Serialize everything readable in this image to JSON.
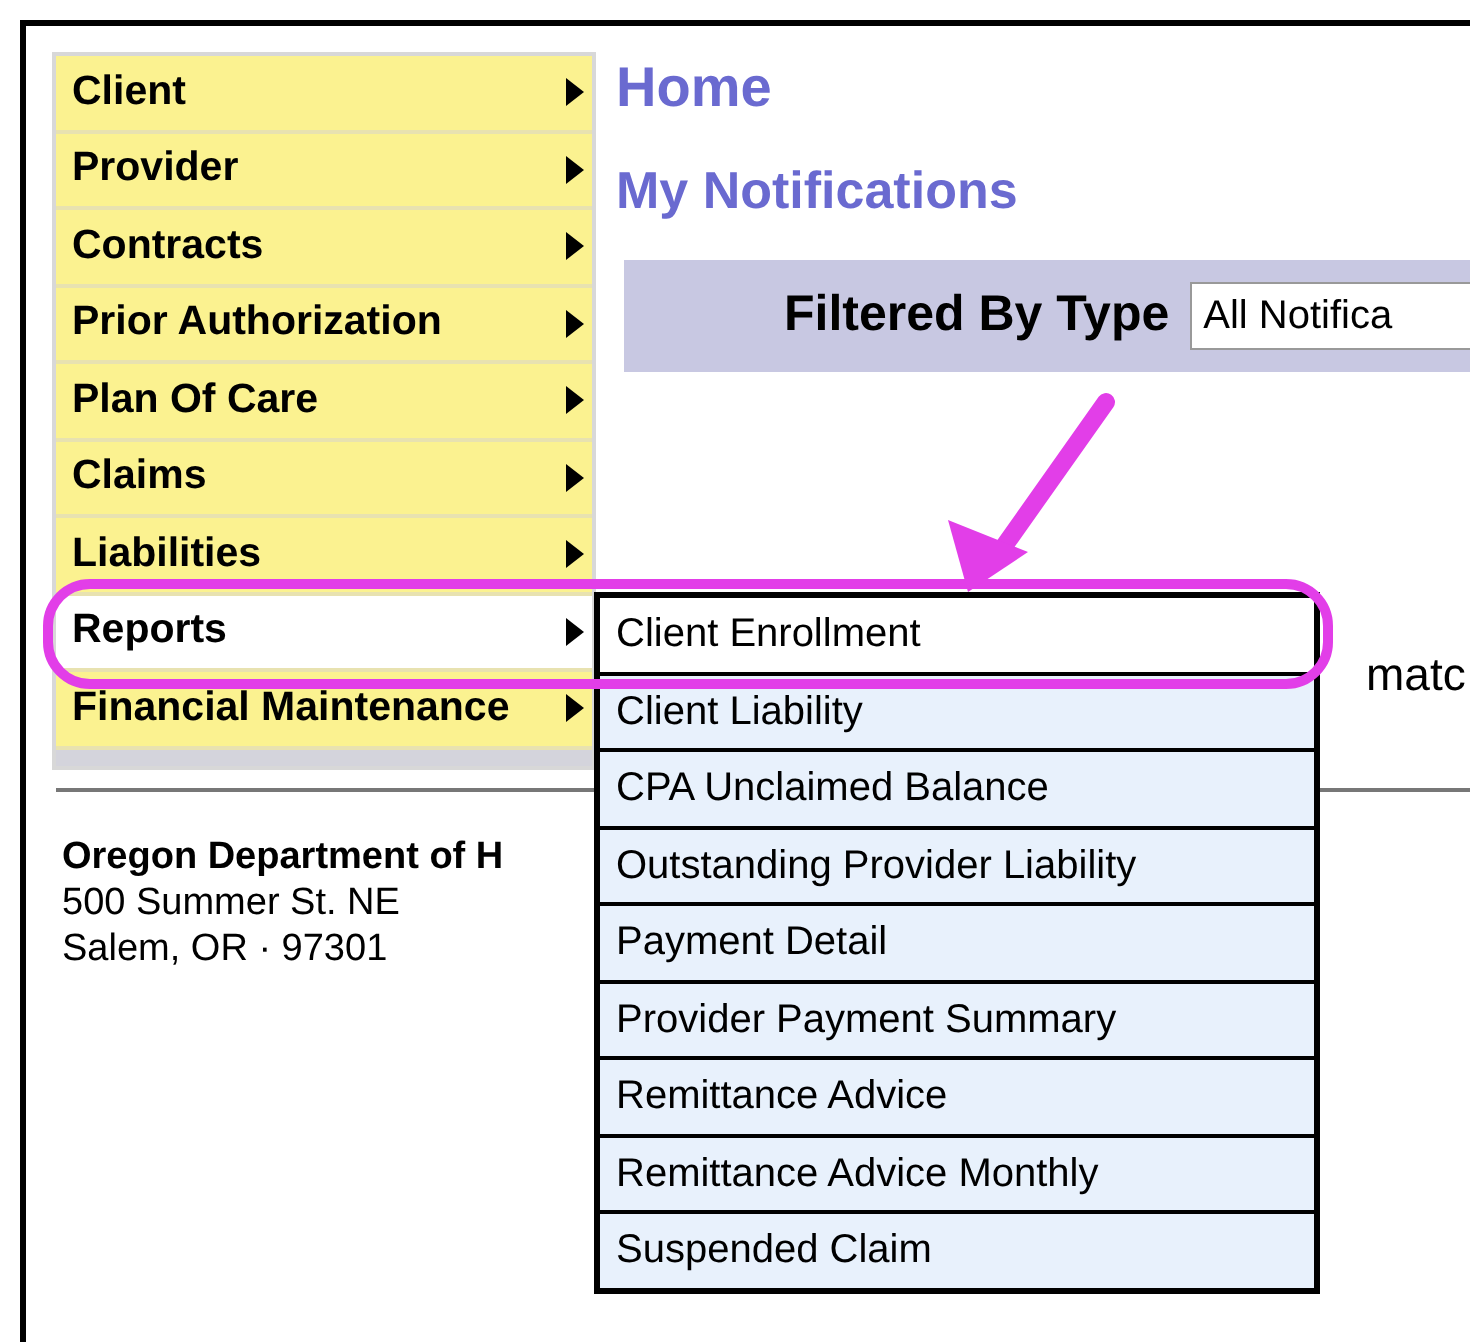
{
  "sidebar": {
    "items": [
      {
        "label": "Client",
        "selected": false
      },
      {
        "label": "Provider",
        "selected": false
      },
      {
        "label": "Contracts",
        "selected": false
      },
      {
        "label": "Prior Authorization",
        "selected": false
      },
      {
        "label": "Plan Of Care",
        "selected": false
      },
      {
        "label": "Claims",
        "selected": false
      },
      {
        "label": "Liabilities",
        "selected": false
      },
      {
        "label": "Reports",
        "selected": true
      },
      {
        "label": "Financial Maintenance",
        "selected": false
      }
    ]
  },
  "page": {
    "title": "Home",
    "section": "My Notifications",
    "filter": {
      "label": "Filtered By Type",
      "value": "All Notifica"
    },
    "partial_text": "matc"
  },
  "submenu": {
    "items": [
      {
        "label": "Client Enrollment",
        "selected": true
      },
      {
        "label": "Client Liability",
        "selected": false
      },
      {
        "label": "CPA Unclaimed Balance",
        "selected": false
      },
      {
        "label": "Outstanding Provider Liability",
        "selected": false
      },
      {
        "label": "Payment Detail",
        "selected": false
      },
      {
        "label": "Provider Payment Summary",
        "selected": false
      },
      {
        "label": "Remittance Advice",
        "selected": false
      },
      {
        "label": "Remittance Advice Monthly",
        "selected": false
      },
      {
        "label": "Suspended Claim",
        "selected": false
      }
    ]
  },
  "footer": {
    "org": "Oregon Department of H",
    "address": [
      "500 Summer St. NE",
      "Salem, OR · 97301"
    ]
  }
}
